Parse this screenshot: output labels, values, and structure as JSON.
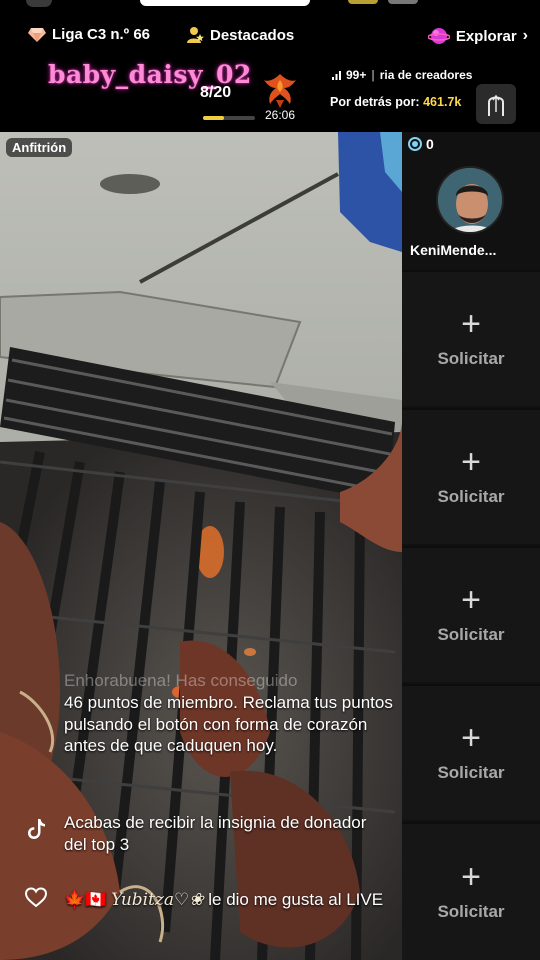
{
  "header": {
    "league_label": "Liga C3 n.º 66",
    "featured_label": "Destacados",
    "explore_label": "Explorar",
    "host_name": "baby_daisy_02",
    "goal_count": "8/20",
    "goal_progress": 0.4,
    "timer": "26:06",
    "rank_count": "99+",
    "rank_text": "ria de creadores",
    "behind_label": "Por detrás por:",
    "behind_value": "461.7k"
  },
  "stream": {
    "host_badge": "Anfitrión"
  },
  "chat": {
    "faded_line": "Enhorabuena! Has conseguido",
    "member_message": "46 puntos de miembro. Reclama tus puntos pulsando el botón con forma de corazón antes de que caduquen hoy.",
    "badge_message": "Acabas de recibir la insignia de donador del top 3",
    "like_user": "Yubitza♡❀",
    "like_message_pre": "🍁🇨🇦",
    "like_message_post": "le dio me gusta al LIVE"
  },
  "side_panel": {
    "viewer_count": "0",
    "guest_name": "KeniMende...",
    "slots": [
      {
        "label": "Solicitar"
      },
      {
        "label": "Solicitar"
      },
      {
        "label": "Solicitar"
      },
      {
        "label": "Solicitar"
      },
      {
        "label": "Solicitar"
      }
    ]
  },
  "colors": {
    "host_name": "#ff8ad6",
    "goal_bar": "#f0d040",
    "behind_value": "#ffd94a",
    "viewer_dot": "#7fd3f5"
  },
  "icons": {
    "league": "diamond-icon",
    "featured": "person-star-icon",
    "explore": "purple-planet-icon",
    "gift": "phoenix-gift-icon",
    "rank": "rank-arch-icon",
    "tiktok": "tiktok-icon",
    "like": "heart-icon"
  }
}
